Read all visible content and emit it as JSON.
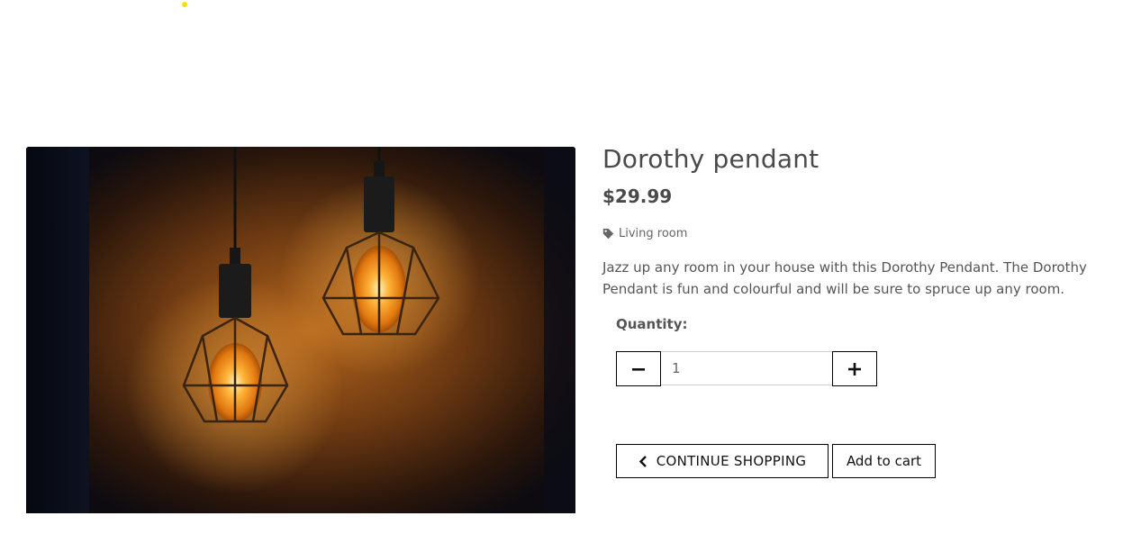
{
  "product": {
    "title": "Dorothy pendant",
    "price": "$29.99",
    "category": "Living room",
    "description": "Jazz up any room in your house with this Dorothy Pendant. The Dorothy Pendant is fun and colourful and will be sure to spruce up any room."
  },
  "quantity": {
    "label": "Quantity:",
    "value": "1"
  },
  "actions": {
    "continue_label": "CONTINUE SHOPPING",
    "add_to_cart_label": "Add to cart"
  },
  "icons": {
    "category": "tag-icon",
    "decrease": "minus-icon",
    "increase": "plus-icon",
    "continue": "chevron-left-icon"
  },
  "colors": {
    "accent_dot": "#f5e000",
    "text": "#4a4a4a",
    "border": "#000000"
  }
}
